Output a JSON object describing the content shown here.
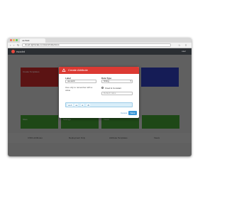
{
  "browser": {
    "tab_title": "ua-flask",
    "url": "cloud.rightscale.com/acct/collections",
    "back_icon": "arrow-left",
    "forward_icon": "arrow-right",
    "reload_icon": "reload",
    "traffic_light_colors": [
      "#ee6a5f",
      "#f5be4f",
      "#62c655"
    ]
  },
  "app": {
    "brand": "rsoolnt",
    "user_label": "user",
    "logo_color": "#e8473c",
    "tiles": [
      {
        "label": "Create Templates",
        "color": "#cb2c2c"
      },
      {
        "label": "",
        "color": "#2f3fbf"
      },
      {
        "label": "Sites",
        "color": "#44a033"
      },
      {
        "label": "Settings",
        "color": "#44a033"
      },
      {
        "label": "Views",
        "color": "#44a033"
      },
      {
        "label": "",
        "color": "#44a033"
      }
    ],
    "stats": [
      "3,501 Attributes",
      "Deployment Only",
      "Attribute Templates",
      "Views"
    ]
  },
  "modal": {
    "title": "Create Attribute",
    "header_icon": "attribute-icon",
    "header_color": "#dc3a33",
    "name_label": "Label",
    "name_value": "ua-work",
    "description_text": "Use only to remember with a value",
    "type_label": "Data Type",
    "type_value": "String",
    "radio_option": "Fixed & Constant",
    "default_placeholder": "Default value",
    "tags": [
      "web",
      "ua",
      "ia",
      "db"
    ],
    "save_label": "Save",
    "cancel_label": "Cancel",
    "primary_color": "#3c98d6"
  }
}
